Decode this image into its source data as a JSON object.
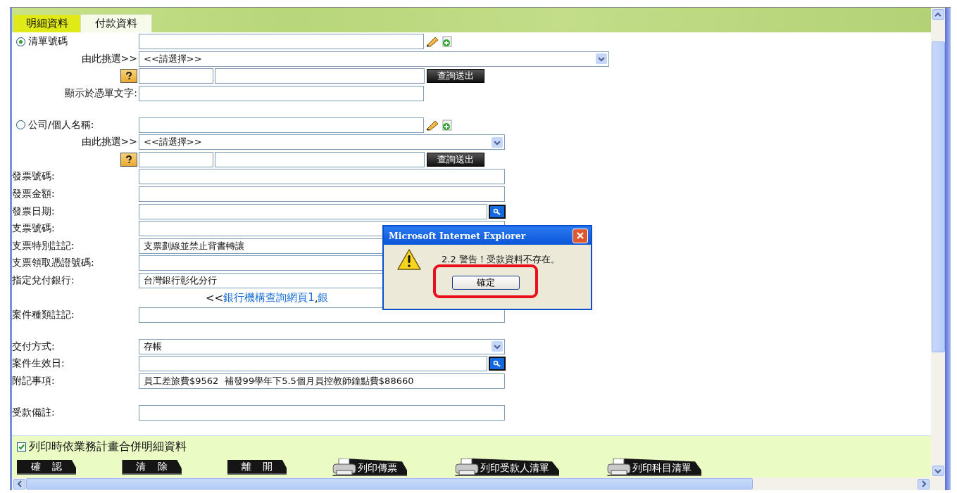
{
  "tabs": [
    {
      "label": "明細資料",
      "selected": false
    },
    {
      "label": "付款資料",
      "selected": true
    }
  ],
  "rows": [
    {
      "kind": "radio",
      "label": "清單號碼",
      "selected": true
    },
    {
      "kind": "pick",
      "label": "由此挑選>>",
      "value": "<<請選擇>>"
    },
    {
      "kind": "query",
      "button": "查詢送出"
    },
    {
      "kind": "caption",
      "label": "顯示於憑單文字:"
    },
    {
      "kind": "spacer"
    },
    {
      "kind": "radio",
      "label": "公司/個人名稱:",
      "selected": false
    },
    {
      "kind": "pick",
      "label": "由此挑選>>",
      "value": "<<請選擇>>"
    },
    {
      "kind": "query",
      "button": "查詢送出"
    },
    {
      "kind": "input",
      "label": "發票號碼:"
    },
    {
      "kind": "input",
      "label": "發票金額:"
    },
    {
      "kind": "date",
      "label": "發票日期:"
    },
    {
      "kind": "input",
      "label": "支票號碼:"
    },
    {
      "kind": "input",
      "label": "支票特別註記:",
      "value": "支票劃線並禁止背書轉讓"
    },
    {
      "kind": "input",
      "label": "支票領取憑證號碼:"
    },
    {
      "kind": "input",
      "label": "指定兌付銀行:",
      "value": "台灣銀行彰化分行"
    },
    {
      "kind": "links",
      "items": [
        {
          "text": "<<",
          "link": false
        },
        {
          "text": "銀行機構查詢網頁1",
          "link": true
        },
        {
          "text": ",",
          "link": false
        },
        {
          "text": "銀",
          "link": true
        }
      ]
    },
    {
      "kind": "input",
      "label": "案件種類註記:"
    },
    {
      "kind": "spacer"
    },
    {
      "kind": "select",
      "label": "交付方式:",
      "value": "存帳"
    },
    {
      "kind": "date",
      "label": "案件生效日:"
    },
    {
      "kind": "input",
      "label": "附記事項:",
      "value": "員工差旅費$9562  補發99學年下5.5個月員控教師鐘點費$88660"
    },
    {
      "kind": "spacer"
    },
    {
      "kind": "input",
      "label": "受款備註:"
    }
  ],
  "print_option": {
    "label": "列印時依業務計畫合併明細資料",
    "checked": true
  },
  "buttons": [
    {
      "kind": "plain",
      "label": "確 認"
    },
    {
      "kind": "plain",
      "label": "清 除"
    },
    {
      "kind": "plain",
      "label": "離 開"
    },
    {
      "kind": "print",
      "label": "列印傳票"
    },
    {
      "kind": "print",
      "label": "列印受款人清單"
    },
    {
      "kind": "print",
      "label": "列印科目清單"
    }
  ],
  "dialog": {
    "title": "Microsoft Internet Explorer",
    "message": "2.2 警告！受款資料不存在。",
    "button": "確定"
  }
}
